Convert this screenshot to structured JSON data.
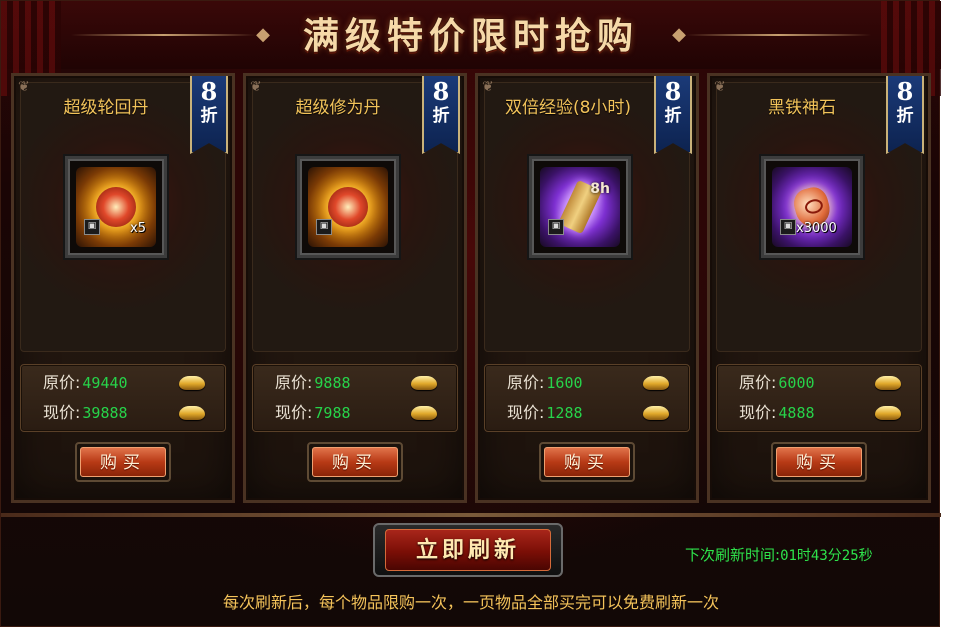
{
  "title": "满级特价限时抢购",
  "colors": {
    "item_name": "#f2c35a",
    "price_value": "#27d34a",
    "timer": "#2ee24b",
    "note": "#f4c35a",
    "ribbon": "#1b3a78"
  },
  "items": [
    {
      "name": "超级轮回丹",
      "discount_num": "8",
      "discount_unit": "折",
      "icon": "orb-icon",
      "art": "gold",
      "qty": "x5",
      "orig_label": "原价:",
      "orig_price": "49440",
      "now_label": "现价:",
      "now_price": "39888",
      "buy_label": "购买"
    },
    {
      "name": "超级修为丹",
      "discount_num": "8",
      "discount_unit": "折",
      "icon": "pill-icon",
      "art": "gold",
      "qty": "",
      "orig_label": "原价:",
      "orig_price": "9888",
      "now_label": "现价:",
      "now_price": "7988",
      "buy_label": "购买"
    },
    {
      "name": "双倍经验(8小时)",
      "discount_num": "8",
      "discount_unit": "折",
      "icon": "exp-scroll-icon",
      "art": "purple",
      "badge": "8h",
      "qty": "",
      "orig_label": "原价:",
      "orig_price": "1600",
      "now_label": "现价:",
      "now_price": "1288",
      "buy_label": "购买"
    },
    {
      "name": "黑铁神石",
      "discount_num": "8",
      "discount_unit": "折",
      "icon": "stone-icon",
      "art": "purple",
      "qty": "x3000",
      "orig_label": "原价:",
      "orig_price": "6000",
      "now_label": "现价:",
      "now_price": "4888",
      "buy_label": "购买"
    }
  ],
  "refresh_label": "立即刷新",
  "timer": {
    "label": "下次刷新时间:",
    "value": "01时43分25秒"
  },
  "note": "每次刷新后，每个物品限购一次，一页物品全部买完可以免费刷新一次"
}
